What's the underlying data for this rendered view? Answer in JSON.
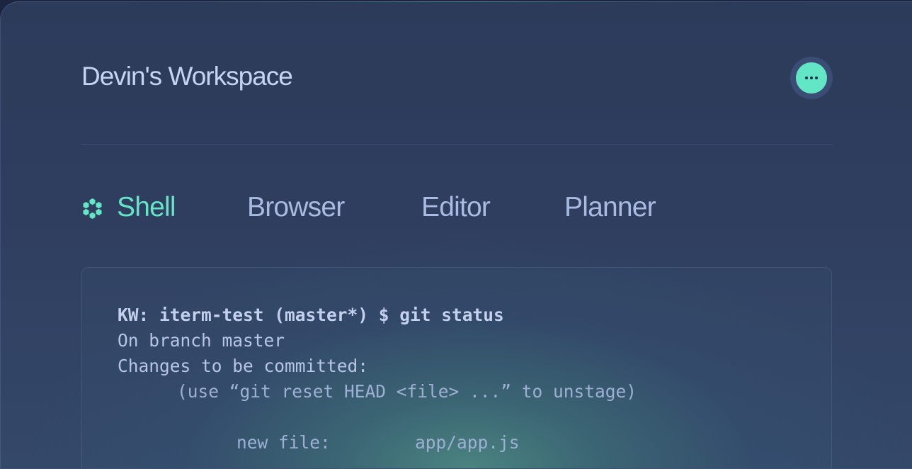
{
  "header": {
    "title": "Devin's Workspace",
    "menu_icon": "ellipsis-icon"
  },
  "tabs": [
    {
      "label": "Shell",
      "active": true,
      "icon": "hexagon-cluster-icon"
    },
    {
      "label": "Browser",
      "active": false
    },
    {
      "label": "Editor",
      "active": false
    },
    {
      "label": "Planner",
      "active": false
    }
  ],
  "terminal": {
    "lines": [
      "KW: iterm-test (master*) $ git status",
      "On branch master",
      "Changes to be committed:",
      "(use “git reset HEAD <file> ...” to unstage)",
      "new file:",
      "app/app.js"
    ]
  },
  "colors": {
    "accent": "#63e6c5",
    "title_text": "#c6d4f4",
    "tab_text": "#a9bbe2",
    "terminal_text": "#b7c5e6",
    "background": "#2f3e5e"
  }
}
